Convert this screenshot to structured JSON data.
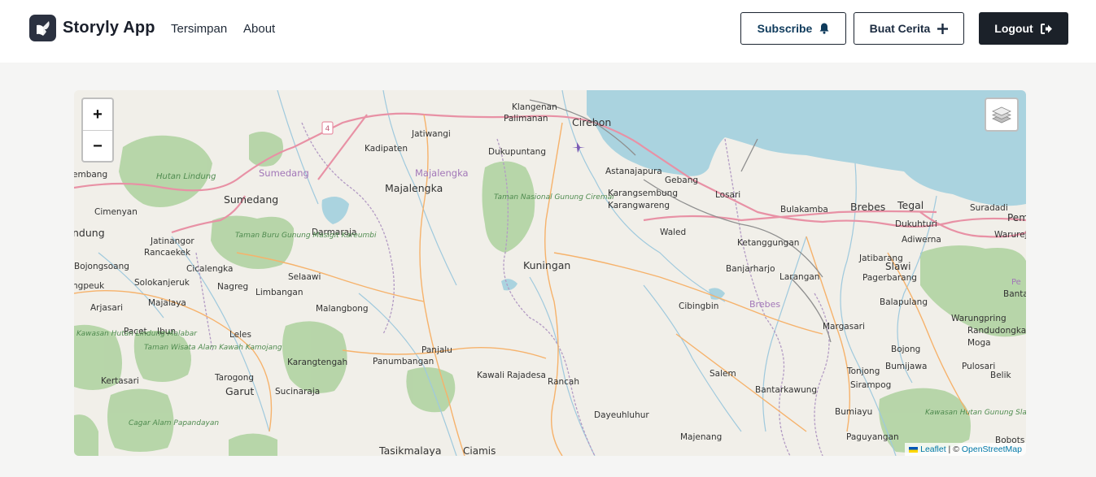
{
  "brand": {
    "name": "Storyly App",
    "logo_icon": "book-feather-icon"
  },
  "nav": {
    "links": [
      "Tersimpan",
      "About"
    ]
  },
  "actions": {
    "subscribe": {
      "label": "Subscribe",
      "icon": "bell-icon"
    },
    "create_story": {
      "label": "Buat Cerita",
      "icon": "plus-icon"
    },
    "logout": {
      "label": "Logout",
      "icon": "logout-icon"
    }
  },
  "map": {
    "zoom_in": "+",
    "zoom_out": "−",
    "layers_icon": "layers-icon",
    "attribution": {
      "leaflet": "Leaflet",
      "separator": " | © ",
      "osm": "OpenStreetMap"
    },
    "places": [
      {
        "name": "Klangenan",
        "kind": "town"
      },
      {
        "name": "Cirebon",
        "kind": "city"
      },
      {
        "name": "Palimanan",
        "kind": "town"
      },
      {
        "name": "Jatiwangi",
        "kind": "town"
      },
      {
        "name": "Kadipaten",
        "kind": "town"
      },
      {
        "name": "Dukupuntang",
        "kind": "town"
      },
      {
        "name": "Sumedang",
        "kind": "region"
      },
      {
        "name": "Majalengka",
        "kind": "region"
      },
      {
        "name": "Sumedang",
        "kind": "city"
      },
      {
        "name": "Majalengka",
        "kind": "city"
      },
      {
        "name": "Hutan Lindung",
        "kind": "park"
      },
      {
        "name": "Taman Nasional Gunung Ciremai",
        "kind": "park"
      },
      {
        "name": "Astanajapura",
        "kind": "town"
      },
      {
        "name": "Gebang",
        "kind": "town"
      },
      {
        "name": "Karangsembung",
        "kind": "town"
      },
      {
        "name": "Losari",
        "kind": "town"
      },
      {
        "name": "Karangwareng",
        "kind": "town"
      },
      {
        "name": "Bulakamba",
        "kind": "town"
      },
      {
        "name": "Brebes",
        "kind": "city"
      },
      {
        "name": "Tegal",
        "kind": "city"
      },
      {
        "name": "Suradadi",
        "kind": "town"
      },
      {
        "name": "Cimenyan",
        "kind": "town"
      },
      {
        "name": "Waled",
        "kind": "town"
      },
      {
        "name": "Dukuhturi",
        "kind": "town"
      },
      {
        "name": "Adiwerna",
        "kind": "town"
      },
      {
        "name": "Warureja",
        "kind": "town"
      },
      {
        "name": "Jatinangor",
        "kind": "town"
      },
      {
        "name": "Darmaraja",
        "kind": "town"
      },
      {
        "name": "Taman Buru Gunung Masigit Kareumbi",
        "kind": "park"
      },
      {
        "name": "Ketanggungan",
        "kind": "town"
      },
      {
        "name": "Rancaekek",
        "kind": "town"
      },
      {
        "name": "Bojongsoang",
        "kind": "town"
      },
      {
        "name": "Cicalengka",
        "kind": "town"
      },
      {
        "name": "Kuningan",
        "kind": "city"
      },
      {
        "name": "Banjarharjo",
        "kind": "town"
      },
      {
        "name": "Jatibarang",
        "kind": "town"
      },
      {
        "name": "Slawi",
        "kind": "city"
      },
      {
        "name": "Solokanjeruk",
        "kind": "town"
      },
      {
        "name": "Selaawi",
        "kind": "town"
      },
      {
        "name": "Larangan",
        "kind": "town"
      },
      {
        "name": "Pagerbarang",
        "kind": "town"
      },
      {
        "name": "Nagreg",
        "kind": "town"
      },
      {
        "name": "Limbangan",
        "kind": "town"
      },
      {
        "name": "Majalaya",
        "kind": "town"
      },
      {
        "name": "Cibingbin",
        "kind": "town"
      },
      {
        "name": "Brebes",
        "kind": "region"
      },
      {
        "name": "Balapulang",
        "kind": "town"
      },
      {
        "name": "Arjasari",
        "kind": "town"
      },
      {
        "name": "Malangbong",
        "kind": "town"
      },
      {
        "name": "Warungpring",
        "kind": "town"
      },
      {
        "name": "Pacet",
        "kind": "town"
      },
      {
        "name": "Ibun",
        "kind": "town"
      },
      {
        "name": "Margasari",
        "kind": "town"
      },
      {
        "name": "Randudongkal",
        "kind": "town"
      },
      {
        "name": "Leles",
        "kind": "town"
      },
      {
        "name": "Kawasan Hutan Lindung Malabar",
        "kind": "park"
      },
      {
        "name": "Taman Wisata Alam Kawah Kamojang",
        "kind": "park"
      },
      {
        "name": "Panjalu",
        "kind": "town"
      },
      {
        "name": "Bojong",
        "kind": "town"
      },
      {
        "name": "Moga",
        "kind": "town"
      },
      {
        "name": "Karangtengah",
        "kind": "town"
      },
      {
        "name": "Panumbangan",
        "kind": "town"
      },
      {
        "name": "Bumijawa",
        "kind": "town"
      },
      {
        "name": "Pulosari",
        "kind": "town"
      },
      {
        "name": "Tonjong",
        "kind": "town"
      },
      {
        "name": "Kertasari",
        "kind": "town"
      },
      {
        "name": "Kawali",
        "kind": "town"
      },
      {
        "name": "Rajadesa",
        "kind": "town"
      },
      {
        "name": "Rancah",
        "kind": "town"
      },
      {
        "name": "Salem",
        "kind": "town"
      },
      {
        "name": "Belik",
        "kind": "town"
      },
      {
        "name": "Tarogong",
        "kind": "town"
      },
      {
        "name": "Sirampog",
        "kind": "town"
      },
      {
        "name": "Garut",
        "kind": "city"
      },
      {
        "name": "Sucinaraja",
        "kind": "town"
      },
      {
        "name": "Bantarkawung",
        "kind": "town"
      },
      {
        "name": "Kawasan Hutan Gunung Slamet",
        "kind": "park"
      },
      {
        "name": "Cagar Alam Papandayan",
        "kind": "park"
      },
      {
        "name": "Bumiayu",
        "kind": "town"
      },
      {
        "name": "Dayeuhluhur",
        "kind": "town"
      },
      {
        "name": "Majenang",
        "kind": "town"
      },
      {
        "name": "Paguyangan",
        "kind": "town"
      },
      {
        "name": "Tasikmalaya",
        "kind": "city"
      },
      {
        "name": "Ciamis",
        "kind": "city"
      },
      {
        "name": "Bobots",
        "kind": "town"
      },
      {
        "name": "Bantar",
        "kind": "town"
      },
      {
        "name": "Pem",
        "kind": "town"
      },
      {
        "name": "ndung",
        "kind": "city"
      },
      {
        "name": "embang",
        "kind": "town"
      },
      {
        "name": "ngpeuk",
        "kind": "town"
      },
      {
        "name": "Pe",
        "kind": "region"
      },
      {
        "name": "4",
        "kind": "shield"
      }
    ]
  }
}
